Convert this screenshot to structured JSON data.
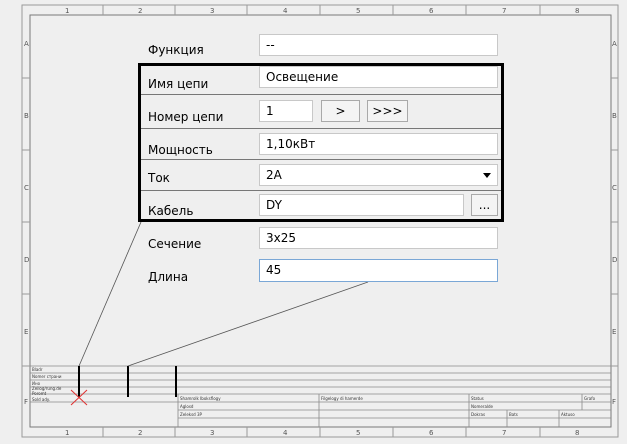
{
  "frame": {
    "col_numbers_top": [
      "1",
      "2",
      "3",
      "4",
      "5",
      "6",
      "7",
      "8"
    ],
    "col_numbers_bottom": [
      "1",
      "2",
      "3",
      "4",
      "5",
      "6",
      "7",
      "8"
    ],
    "row_letters": [
      "A",
      "B",
      "C",
      "D",
      "E",
      "F"
    ],
    "title_block": {
      "left_labels": [
        "Bladr",
        "Nomer страни",
        "Ино",
        "Zeilog/rung.de",
        "Poromt",
        "Sold ady."
      ],
      "cells": [
        "Shamrolk Iboksflogy",
        "Filgelogy di hamerde",
        "Status",
        "Grafo",
        "Aglosd",
        "Nomeralde",
        "Zeleksd 3P",
        "Dokras",
        "Bats",
        "Aktuso"
      ]
    }
  },
  "form": {
    "rows": [
      {
        "label": "Функция",
        "value": "--"
      },
      {
        "label": "Имя цепи",
        "value": "Освещение"
      },
      {
        "label": "Номер цепи",
        "value": "1"
      },
      {
        "label": "Мощность",
        "value": "1,10кВт"
      },
      {
        "label": "Ток",
        "value": "2А"
      },
      {
        "label": "Кабель",
        "value": "DY"
      },
      {
        "label": "Сечение",
        "value": "3х25"
      },
      {
        "label": "Длина",
        "value": "45"
      }
    ],
    "step_next_label": ">",
    "step_end_label": ">>>",
    "browse_label": "..."
  }
}
